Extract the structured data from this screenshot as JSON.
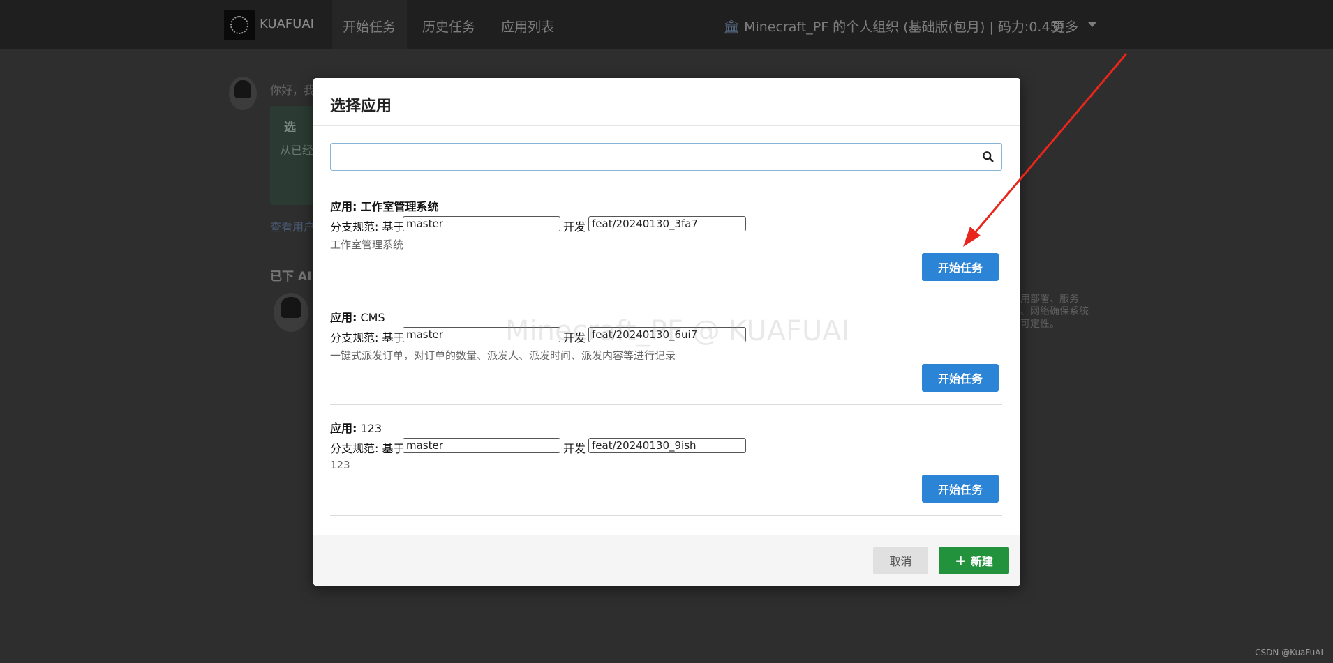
{
  "topnav": {
    "brand": "KUAFUAI",
    "items": [
      "开始任务",
      "历史任务",
      "应用列表"
    ],
    "org": "Minecraft_PF 的个人组织 (基础版(包月) | 码力:0.45)",
    "more": "更多"
  },
  "background": {
    "greeting": "你好，我",
    "card_title": "选",
    "card_text": "从已经",
    "link_text": "查看用户",
    "section_title": "已下 AI 为",
    "side_text": "应用部署、服务器、网络确保系统的可定性。",
    "watermark": "Minecraft_PF @ KUAFUAI",
    "csdn": "CSDN @KuaFuAI"
  },
  "modal": {
    "title": "选择应用",
    "search": {
      "value": "",
      "placeholder": ""
    },
    "branch_label": "分支规范: 基于",
    "dev_label": "开发",
    "app_label": "应用:",
    "start_label": "开始任务",
    "apps": [
      {
        "name": "工作室管理系统",
        "base_branch": "master",
        "dev_branch": "feat/20240130_3fa7",
        "description": "工作室管理系统"
      },
      {
        "name": "CMS",
        "base_branch": "master",
        "dev_branch": "feat/20240130_6ui7",
        "description": "一键式派发订单，对订单的数量、派发人、派发时间、派发内容等进行记录"
      },
      {
        "name": "123",
        "base_branch": "master",
        "dev_branch": "feat/20240130_9ish",
        "description": "123"
      }
    ],
    "footer": {
      "cancel": "取消",
      "new": "新建"
    }
  },
  "colors": {
    "primary": "#2b84d6",
    "success": "#22923d",
    "annotation": "#e8261c"
  }
}
